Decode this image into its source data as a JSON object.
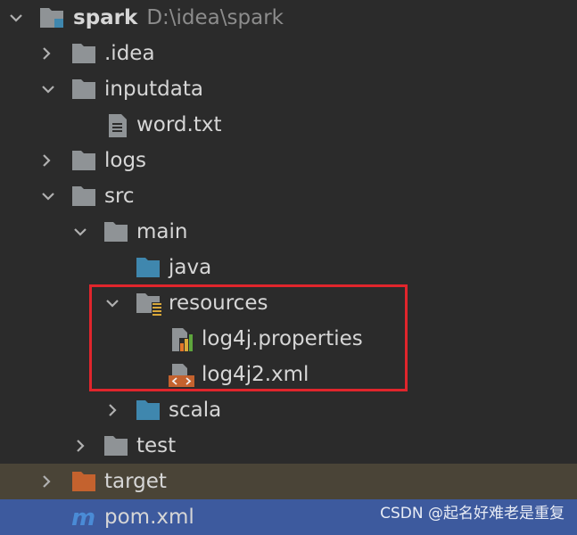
{
  "project": {
    "name": "spark",
    "path": "D:\\idea\\spark"
  },
  "tree": {
    "idea": ".idea",
    "inputdata": "inputdata",
    "word_txt": "word.txt",
    "logs": "logs",
    "src": "src",
    "main": "main",
    "java": "java",
    "resources": "resources",
    "log4j_properties": "log4j.properties",
    "log4j2_xml": "log4j2.xml",
    "scala": "scala",
    "test": "test",
    "target": "target",
    "pom_xml": "pom.xml"
  },
  "watermark": "CSDN @起名好难老是重复",
  "colors": {
    "folder_gray": "#8f9396",
    "folder_blue": "#3f87ae",
    "folder_orange": "#c4622e",
    "highlight": "#e0252c",
    "selection": "#3d5a9e",
    "excluded_row": "#4a4437",
    "maven_blue": "#4a8bd6"
  },
  "icons": {
    "expanded": "chevron-down-icon",
    "collapsed": "chevron-right-icon",
    "folder": "folder-icon",
    "source_folder": "source-folder-icon",
    "resources_folder": "resources-folder-icon",
    "text_file": "text-file-icon",
    "properties_file": "properties-file-icon",
    "xml_file": "xml-file-icon",
    "excluded_folder": "excluded-folder-icon",
    "maven": "maven-icon"
  }
}
